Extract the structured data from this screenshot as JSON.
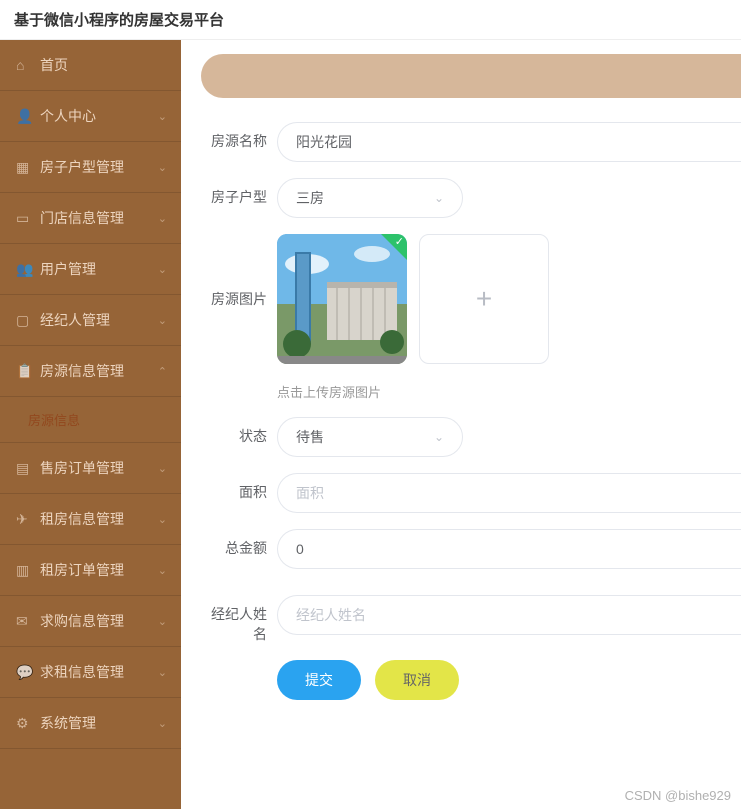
{
  "header": {
    "title": "基于微信小程序的房屋交易平台"
  },
  "sidebar": {
    "items": [
      {
        "label": "首页",
        "icon": "home"
      },
      {
        "label": "个人中心",
        "icon": "user",
        "chev": "down"
      },
      {
        "label": "房子户型管理",
        "icon": "grid",
        "chev": "down"
      },
      {
        "label": "门店信息管理",
        "icon": "store",
        "chev": "down"
      },
      {
        "label": "用户管理",
        "icon": "users",
        "chev": "down"
      },
      {
        "label": "经纪人管理",
        "icon": "agent",
        "chev": "down"
      },
      {
        "label": "房源信息管理",
        "icon": "doc",
        "chev": "up",
        "expanded": true,
        "sub": "房源信息"
      },
      {
        "label": "售房订单管理",
        "icon": "order",
        "chev": "down"
      },
      {
        "label": "租房信息管理",
        "icon": "plane",
        "chev": "down"
      },
      {
        "label": "租房订单管理",
        "icon": "rent",
        "chev": "down"
      },
      {
        "label": "求购信息管理",
        "icon": "mail",
        "chev": "down"
      },
      {
        "label": "求租信息管理",
        "icon": "chat",
        "chev": "down"
      },
      {
        "label": "系统管理",
        "icon": "sys",
        "chev": "down"
      }
    ]
  },
  "form": {
    "name": {
      "label": "房源名称",
      "value": "阳光花园"
    },
    "type": {
      "label": "房子户型",
      "value": "三房"
    },
    "image": {
      "label": "房源图片",
      "hint": "点击上传房源图片"
    },
    "status": {
      "label": "状态",
      "value": "待售"
    },
    "area": {
      "label": "面积",
      "placeholder": "面积",
      "value": ""
    },
    "total": {
      "label": "总金额",
      "value": "0"
    },
    "agent": {
      "label": "经纪人姓名",
      "placeholder": "经纪人姓名",
      "value": ""
    }
  },
  "buttons": {
    "submit": "提交",
    "cancel": "取消"
  },
  "watermark": "CSDN @bishe929"
}
